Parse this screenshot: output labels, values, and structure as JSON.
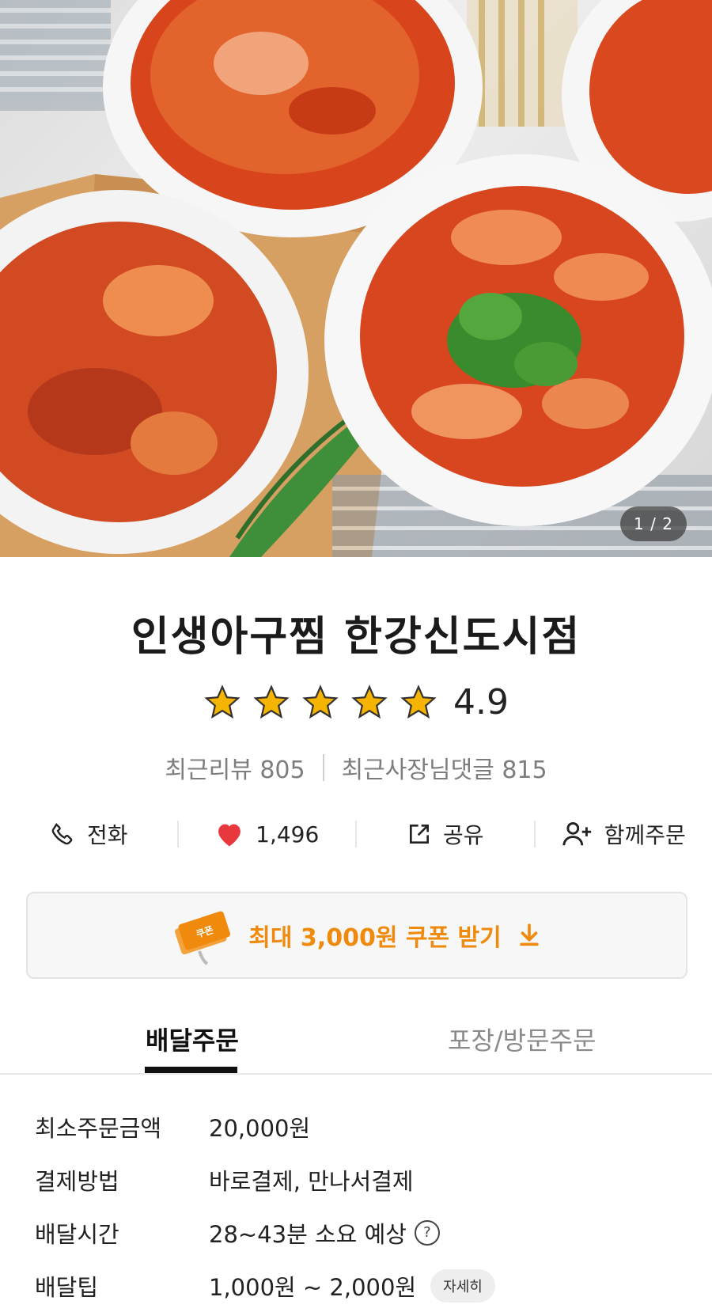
{
  "hero": {
    "pager": "1 / 2"
  },
  "store": {
    "name": "인생아구찜 한강신도시점",
    "rating": "4.9",
    "stars": 5,
    "recent_reviews": "최근리뷰 805",
    "owner_replies": "최근사장님댓글 815"
  },
  "actions": [
    {
      "label": "전화",
      "icon": "phone-icon"
    },
    {
      "label": "1,496",
      "icon": "heart-icon"
    },
    {
      "label": "공유",
      "icon": "share-icon"
    },
    {
      "label": "함께주문",
      "icon": "add-person-icon"
    }
  ],
  "coupon": {
    "label": "최대 3,000원 쿠폰 받기",
    "ticket_text": "쿠폰"
  },
  "tabs": [
    {
      "label": "배달주문",
      "active": true
    },
    {
      "label": "포장/방문주문",
      "active": false
    }
  ],
  "info": [
    {
      "label": "최소주문금액",
      "value": "20,000원"
    },
    {
      "label": "결제방법",
      "value": "바로결제, 만나서결제"
    },
    {
      "label": "배달시간",
      "value": "28~43분 소요 예상",
      "help": "?"
    },
    {
      "label": "배달팁",
      "value": "1,000원 ~ 2,000원",
      "button": "자세히"
    }
  ],
  "colors": {
    "accent": "#f08a0c",
    "heart": "#e8383d",
    "star": "#f5b400"
  }
}
